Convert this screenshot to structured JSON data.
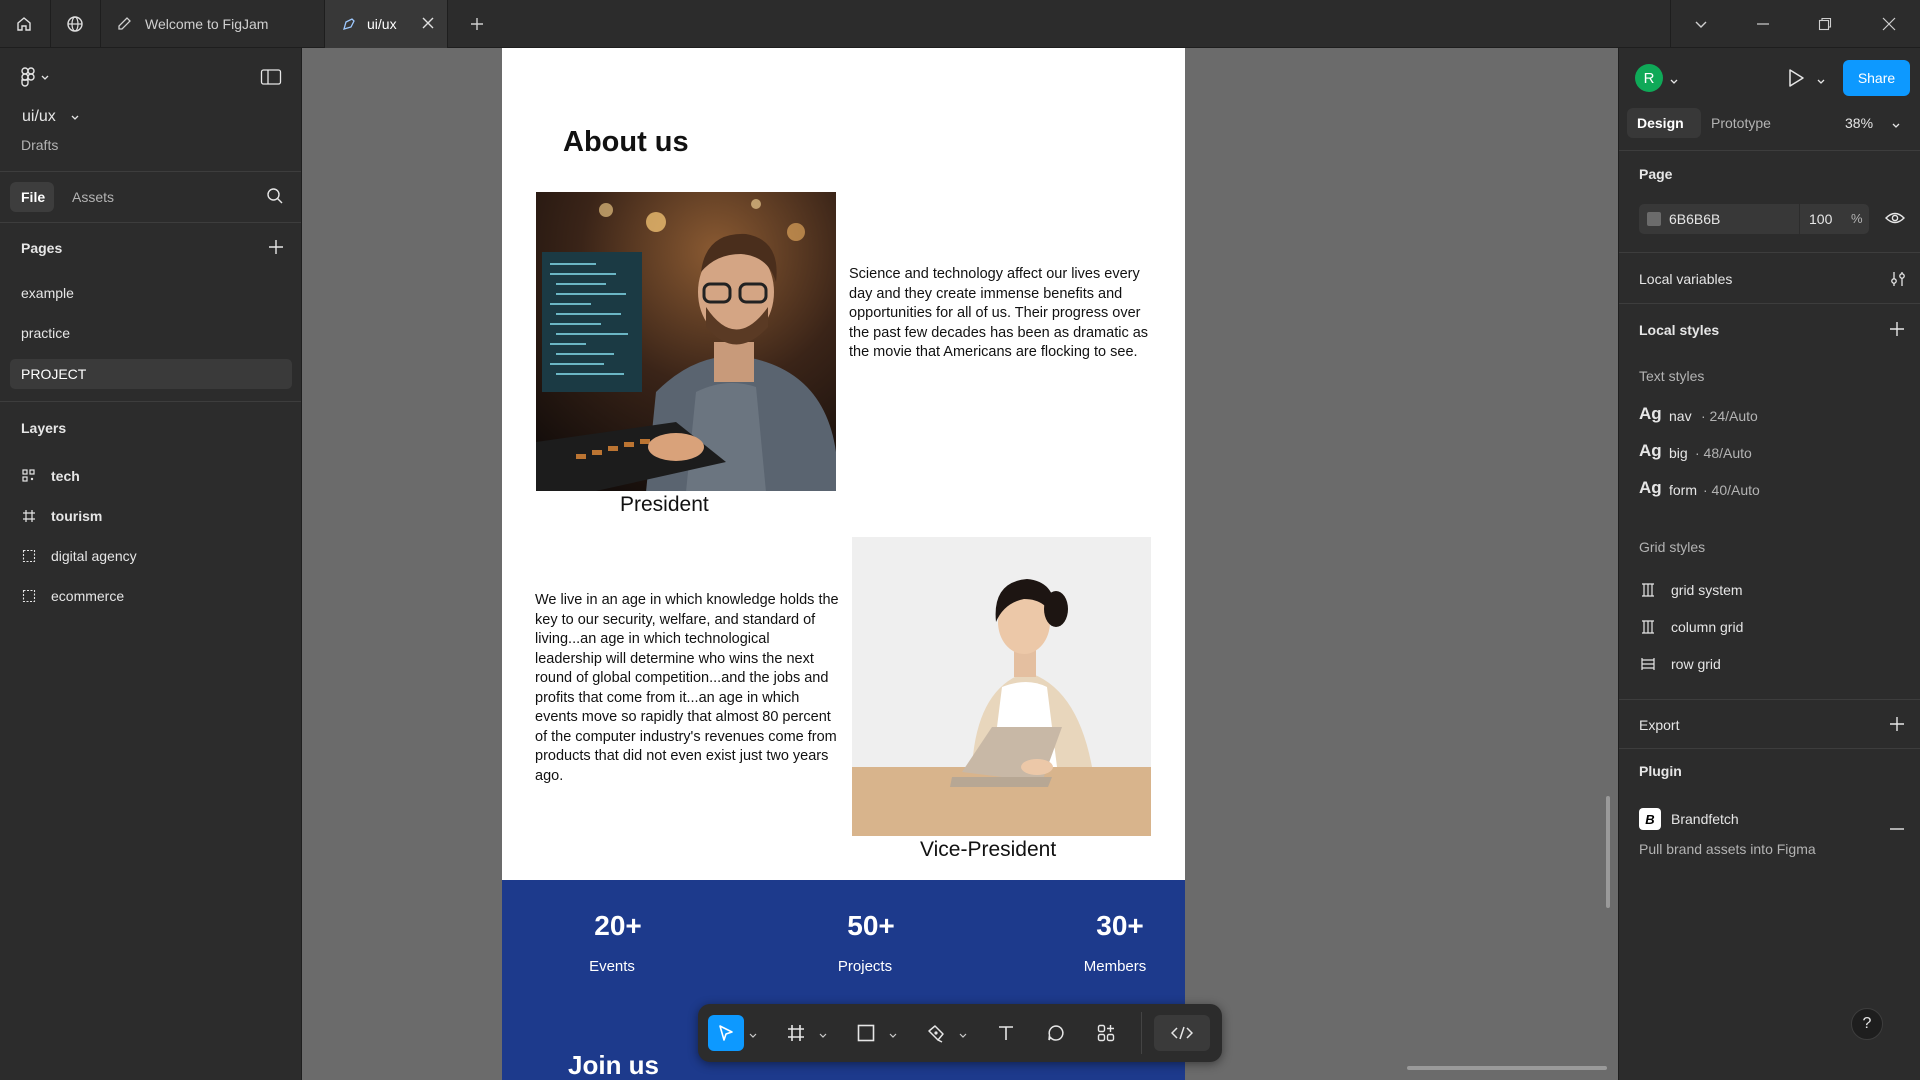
{
  "titlebar": {
    "tabs": [
      {
        "label": "Welcome to FigJam"
      },
      {
        "label": "ui/ux"
      }
    ]
  },
  "left_panel": {
    "file_name": "ui/ux",
    "location": "Drafts",
    "tabs": {
      "file": "File",
      "assets": "Assets"
    },
    "pages_heading": "Pages",
    "pages": [
      {
        "label": "example"
      },
      {
        "label": "practice"
      },
      {
        "label": "PROJECT"
      }
    ],
    "layers_heading": "Layers",
    "layers": [
      {
        "label": "tech",
        "icon": "component-set-icon"
      },
      {
        "label": "tourism",
        "icon": "frame-icon"
      },
      {
        "label": "digital agency",
        "icon": "section-icon"
      },
      {
        "label": "ecommerce",
        "icon": "section-icon"
      }
    ]
  },
  "frame": {
    "title": "About us",
    "president_text": "Science and technology affect our lives every day and they create immense benefits and opportunities for all of us. Their progress over the past few decades has been as dramatic as the movie that Americans are flocking to see.",
    "president_caption": "President",
    "vp_text": "We live in an age in which knowledge holds the key to our security, welfare, and standard of living...an age in which technological leadership will determine who wins the next round of global competition...and the jobs and profits that come from it...an age in which events move so rapidly that almost 80 percent of the computer industry's revenues come from products that did not even exist just two years ago.",
    "vp_caption": "Vice-President",
    "stats": [
      {
        "value": "20+",
        "label": "Events"
      },
      {
        "value": "50+",
        "label": "Projects"
      },
      {
        "value": "30+",
        "label": "Members"
      }
    ],
    "join_heading": "Join us",
    "stats_bg": "#1d3a8c"
  },
  "right_panel": {
    "avatar_letter": "R",
    "share_label": "Share",
    "tabs": {
      "design": "Design",
      "prototype": "Prototype"
    },
    "zoom": "38%",
    "page_heading": "Page",
    "page_color": "6B6B6B",
    "page_opacity": "100",
    "percent_sign": "%",
    "local_variables": "Local variables",
    "local_styles": "Local styles",
    "text_styles_heading": "Text styles",
    "text_styles": [
      {
        "ag": "Ag",
        "name": "nav",
        "spec": "· 24/Auto"
      },
      {
        "ag": "Ag",
        "name": "big",
        "spec": "· 48/Auto"
      },
      {
        "ag": "Ag",
        "name": "form",
        "spec": "· 40/Auto"
      }
    ],
    "grid_styles_heading": "Grid styles",
    "grid_styles": [
      {
        "label": "grid system"
      },
      {
        "label": "column grid"
      },
      {
        "label": "row grid"
      }
    ],
    "export_heading": "Export",
    "plugin_heading": "Plugin",
    "plugin_name": "Brandfetch",
    "plugin_badge": "B",
    "plugin_desc": "Pull brand assets into Figma",
    "help": "?"
  },
  "colors": {
    "accent": "#0d99ff",
    "avatar": "#0fa958",
    "panel_bg": "#2c2c2c",
    "canvas_bg": "#6b6b6b"
  }
}
